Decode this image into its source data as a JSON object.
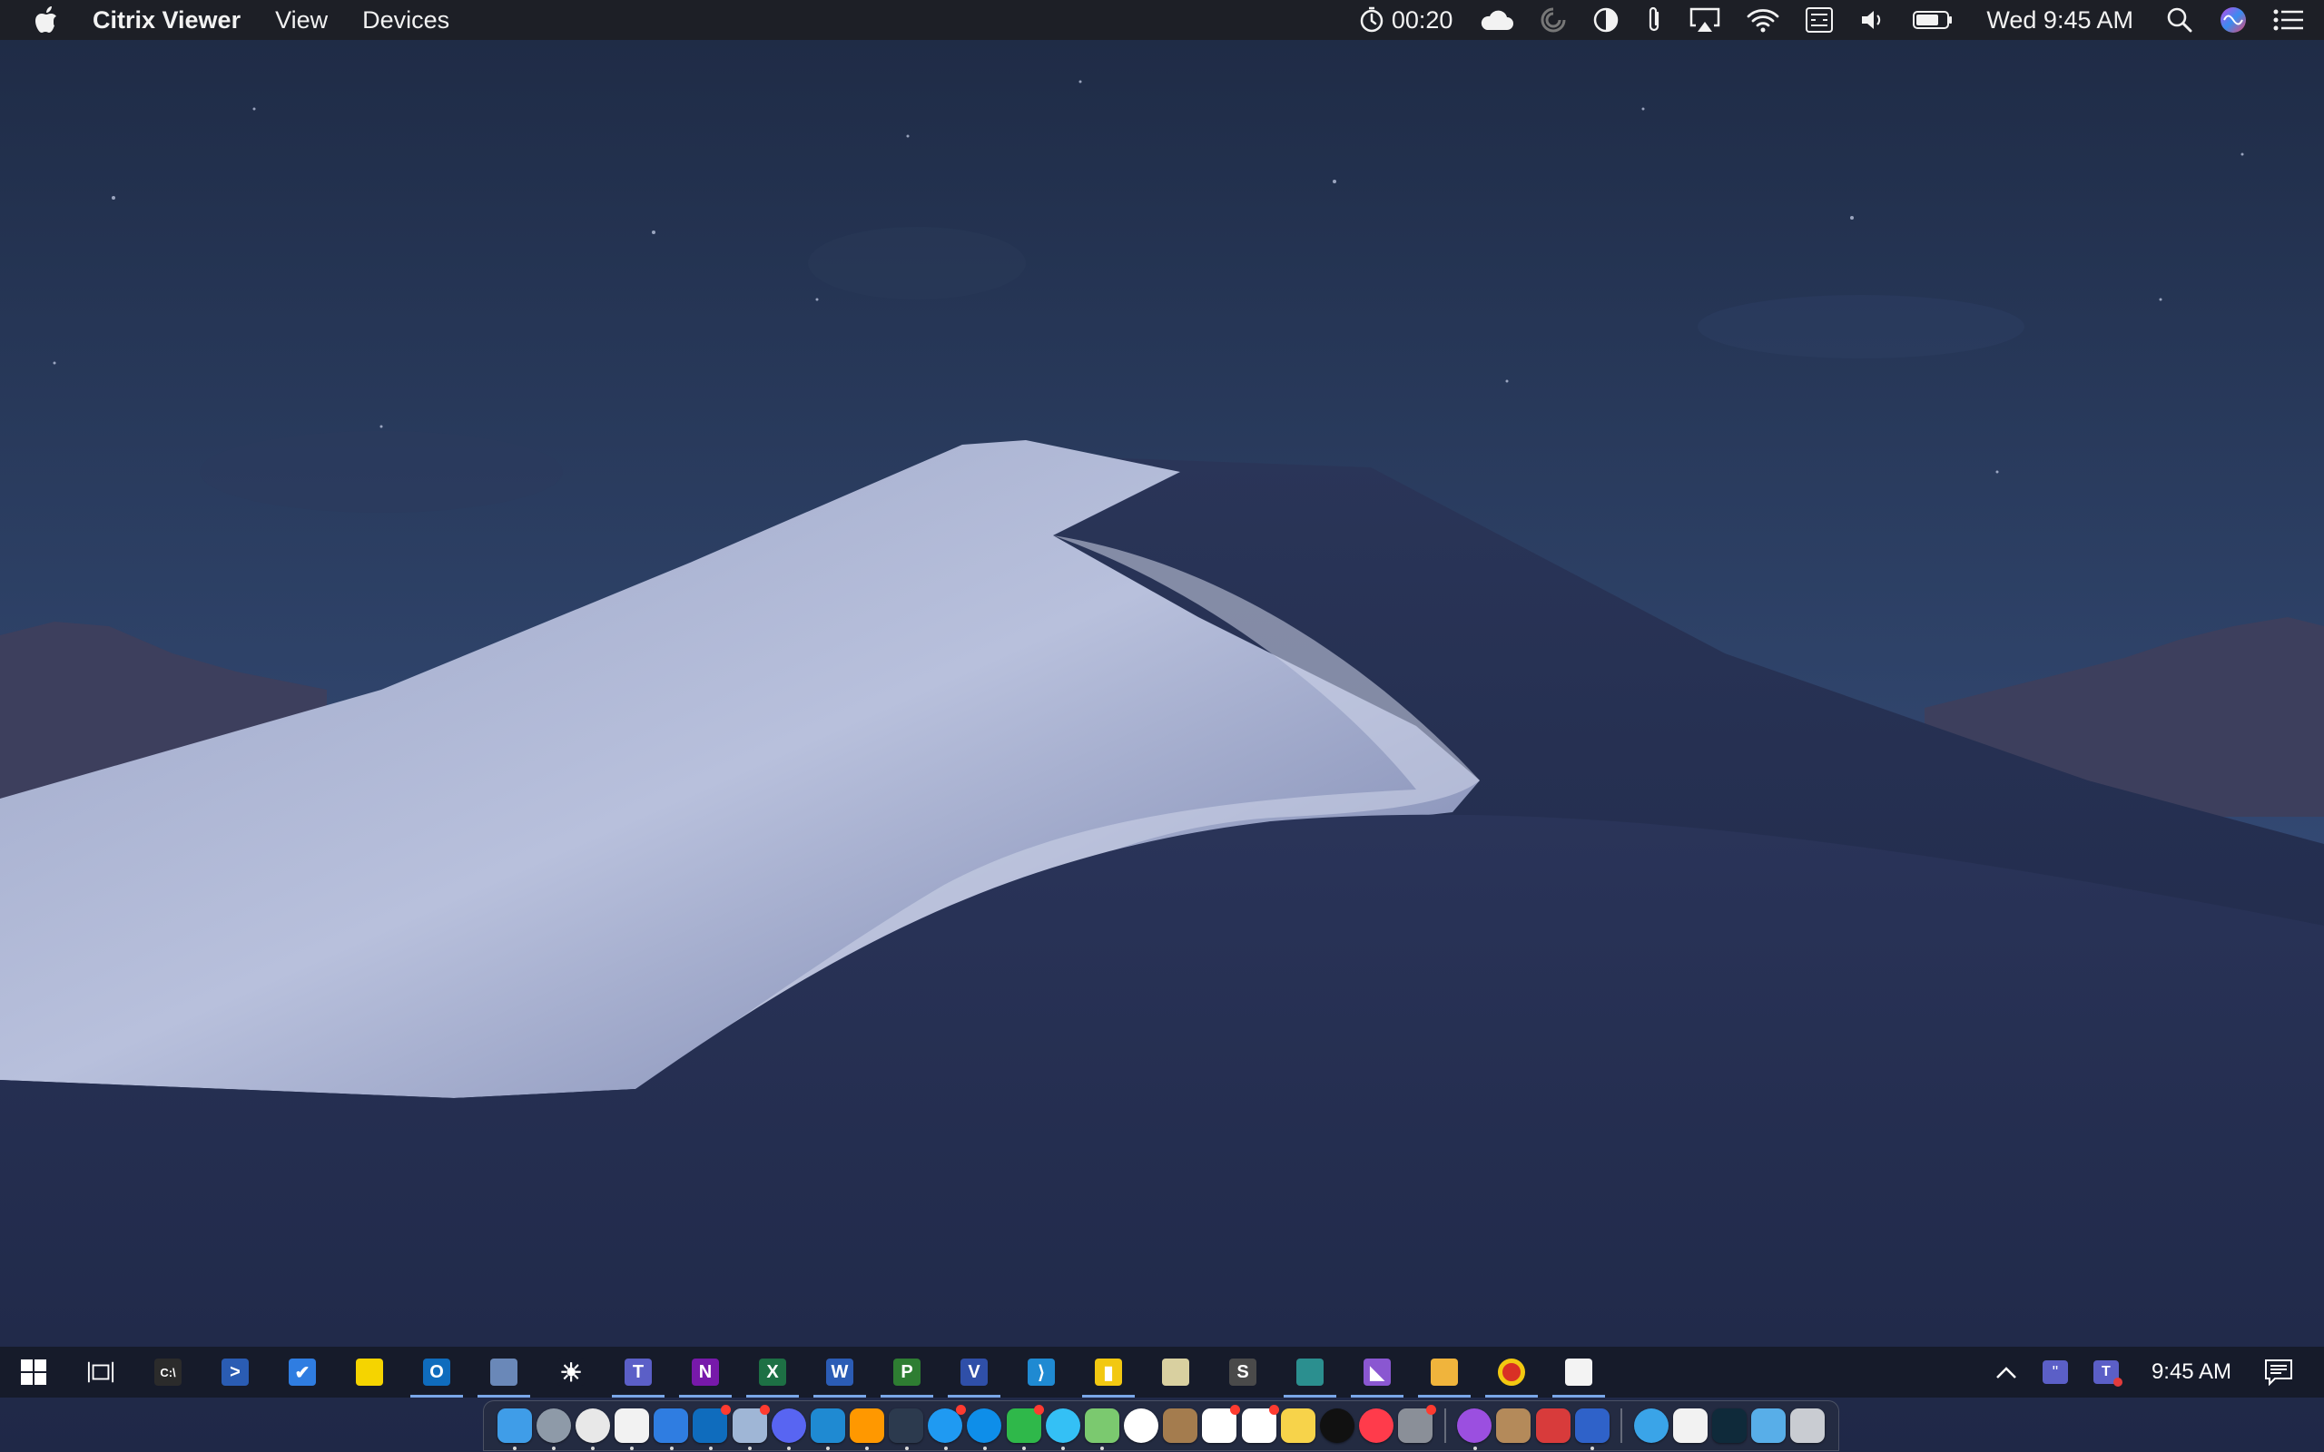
{
  "menubar": {
    "app_name": "Citrix Viewer",
    "menus": [
      "View",
      "Devices"
    ],
    "timer": "00:20",
    "clock": "Wed 9:45 AM",
    "status_icons": [
      "timer-icon",
      "cloud-icon",
      "spinner-icon",
      "display-contrast-icon",
      "paperclip-icon",
      "airplay-icon",
      "wifi-icon",
      "keyboard-icon",
      "volume-icon",
      "battery-icon",
      "spotlight-search-icon",
      "siri-icon",
      "notification-center-icon"
    ]
  },
  "taskbar": {
    "clock": "9:45 AM",
    "apps": [
      {
        "name": "windows-start",
        "glyph": "",
        "color": "#ffffff"
      },
      {
        "name": "task-view",
        "glyph": "",
        "color": "#ffffff"
      },
      {
        "name": "command-prompt",
        "glyph": "C:\\",
        "color": "#2b2b2b"
      },
      {
        "name": "powershell",
        "glyph": ">",
        "color": "#2a5cb3"
      },
      {
        "name": "microsoft-todo",
        "glyph": "✔",
        "color": "#2f7de1"
      },
      {
        "name": "sticky-notes",
        "glyph": "",
        "color": "#f5d400"
      },
      {
        "name": "outlook",
        "glyph": "O",
        "color": "#0f6cbd"
      },
      {
        "name": "photos",
        "glyph": "",
        "color": "#6a88b8"
      },
      {
        "name": "brightness",
        "glyph": "☀",
        "color": "#161b2a"
      },
      {
        "name": "teams",
        "glyph": "T",
        "color": "#5b5fc7"
      },
      {
        "name": "onenote",
        "glyph": "N",
        "color": "#7719aa"
      },
      {
        "name": "excel",
        "glyph": "X",
        "color": "#1d7044"
      },
      {
        "name": "word",
        "glyph": "W",
        "color": "#2b5cb5"
      },
      {
        "name": "project",
        "glyph": "P",
        "color": "#2e7d32"
      },
      {
        "name": "visio",
        "glyph": "V",
        "color": "#2f4fa8"
      },
      {
        "name": "vscode",
        "glyph": "⟩",
        "color": "#1f8ad2"
      },
      {
        "name": "power-bi",
        "glyph": "▮",
        "color": "#f2c811"
      },
      {
        "name": "notepad",
        "glyph": "",
        "color": "#d9d0a0"
      },
      {
        "name": "sublime-text",
        "glyph": "S",
        "color": "#4a4a4a"
      },
      {
        "name": "snip-tool",
        "glyph": "",
        "color": "#2b8f8f"
      },
      {
        "name": "visual-studio",
        "glyph": "◣",
        "color": "#8a57d1"
      },
      {
        "name": "file-explorer",
        "glyph": "",
        "color": "#f0b43c"
      },
      {
        "name": "chrome",
        "glyph": "",
        "color": "#d93025"
      },
      {
        "name": "store",
        "glyph": "",
        "color": "#f3f3f3"
      }
    ],
    "active": [
      "outlook",
      "photos",
      "teams",
      "onenote",
      "excel",
      "word",
      "project",
      "visio",
      "power-bi",
      "snip-tool",
      "visual-studio",
      "file-explorer",
      "chrome",
      "store"
    ]
  },
  "dock": {
    "apps": [
      {
        "name": "finder",
        "color": "#3f9de8",
        "badge": false
      },
      {
        "name": "launchpad",
        "color": "#8e9aa8",
        "badge": false
      },
      {
        "name": "chrome",
        "color": "#e8e8e8",
        "badge": false
      },
      {
        "name": "clock",
        "color": "#f2f2f2",
        "badge": false
      },
      {
        "name": "todo",
        "color": "#2f7de1",
        "badge": false
      },
      {
        "name": "outlook",
        "color": "#0f6cbd",
        "badge": true
      },
      {
        "name": "preview",
        "color": "#9fb6d6",
        "badge": true
      },
      {
        "name": "discord",
        "color": "#5865f2",
        "badge": false
      },
      {
        "name": "vscode",
        "color": "#1f8ad2",
        "badge": false
      },
      {
        "name": "sublime-text",
        "color": "#ff9800",
        "badge": false
      },
      {
        "name": "xcode",
        "color": "#2c3a4e",
        "badge": false
      },
      {
        "name": "app-store",
        "color": "#1f9af2",
        "badge": true
      },
      {
        "name": "teamviewer",
        "color": "#0e8ee9",
        "badge": false
      },
      {
        "name": "facetime",
        "color": "#2fb84a",
        "badge": true
      },
      {
        "name": "messages",
        "color": "#34c0f5",
        "badge": false
      },
      {
        "name": "maps",
        "color": "#7bc96f",
        "badge": false
      },
      {
        "name": "photos",
        "color": "#ffffff",
        "badge": false
      },
      {
        "name": "notebook",
        "color": "#a47c4e",
        "badge": false
      },
      {
        "name": "calendar",
        "color": "#ffffff",
        "badge": true
      },
      {
        "name": "reminders",
        "color": "#ffffff",
        "badge": true
      },
      {
        "name": "notes",
        "color": "#f7d34a",
        "badge": false
      },
      {
        "name": "apple-tv",
        "color": "#111111",
        "badge": false
      },
      {
        "name": "news",
        "color": "#ff3b4b",
        "badge": false
      },
      {
        "name": "system-preferences",
        "color": "#8a8f98",
        "badge": true
      },
      {
        "name": "podcasts",
        "color": "#9b4fe0",
        "badge": false
      },
      {
        "name": "archive-utility",
        "color": "#b48a5a",
        "badge": false
      },
      {
        "name": "remote-desktop",
        "color": "#d83b3b",
        "badge": false
      },
      {
        "name": "citrix-viewer",
        "color": "#2f62c9",
        "badge": false
      },
      {
        "name": "network",
        "color": "#3aa4e8",
        "badge": false
      },
      {
        "name": "document",
        "color": "#f2f2f2",
        "badge": false
      },
      {
        "name": "lightroom",
        "color": "#0f2a3a",
        "badge": false
      },
      {
        "name": "downloads-folder",
        "color": "#58aee8",
        "badge": false
      },
      {
        "name": "trash",
        "color": "#c9ccd2",
        "badge": false
      }
    ],
    "running": [
      "finder",
      "launchpad",
      "chrome",
      "clock",
      "todo",
      "outlook",
      "preview",
      "discord",
      "vscode",
      "sublime-text",
      "xcode",
      "app-store",
      "teamviewer",
      "facetime",
      "messages",
      "maps",
      "podcasts",
      "citrix-viewer"
    ]
  }
}
